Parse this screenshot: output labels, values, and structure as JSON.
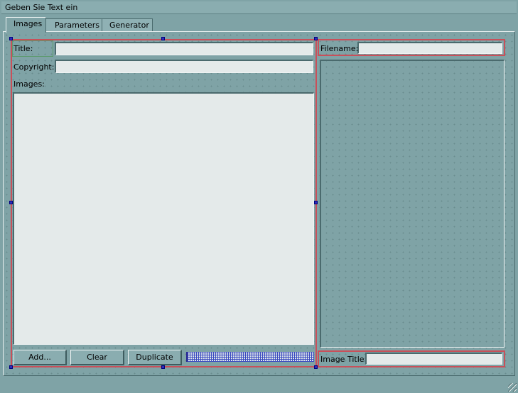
{
  "window": {
    "title": "Geben Sie Text ein"
  },
  "tabs": [
    {
      "label": "Images"
    },
    {
      "label": "Parameters"
    },
    {
      "label": "Generator"
    }
  ],
  "form": {
    "title_label": "Title:",
    "title_value": "",
    "copyright_label": "Copyright:",
    "copyright_value": "",
    "images_label": "Images:",
    "filename_label": "Filename:",
    "filename_value": "",
    "image_title_label": "Image Title:",
    "image_title_value": ""
  },
  "buttons": {
    "add": "Add...",
    "clear": "Clear",
    "duplicate": "Duplicate"
  },
  "colors": {
    "background": "#7fa3a6",
    "selection_border": "#c9505a",
    "handle": "#2e2eb8"
  }
}
